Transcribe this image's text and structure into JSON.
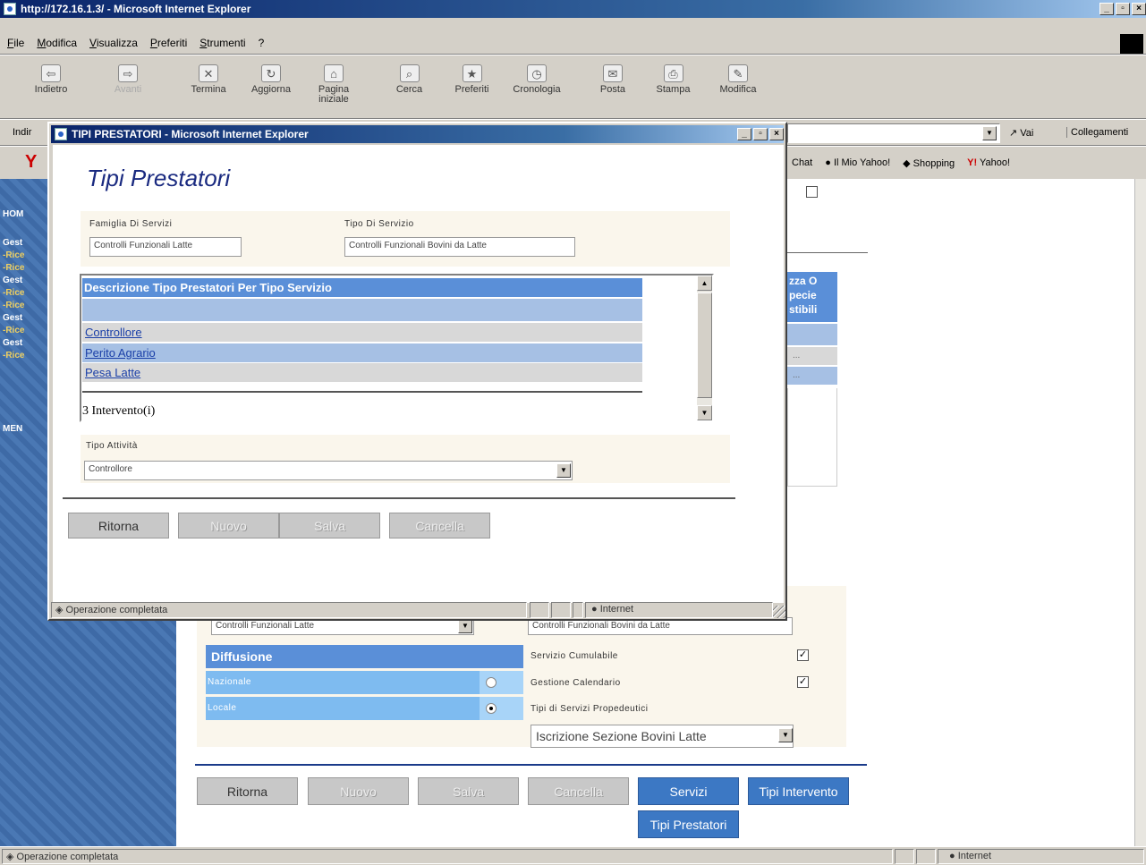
{
  "main_window": {
    "title": "http://172.16.1.3/ - Microsoft Internet Explorer",
    "menu": [
      "File",
      "Modifica",
      "Visualizza",
      "Preferiti",
      "Strumenti",
      "?"
    ],
    "toolbar": [
      "Indietro",
      "Avanti",
      "Termina",
      "Aggiorna",
      "Pagina iniziale",
      "Cerca",
      "Preferiti",
      "Cronologia",
      "Posta",
      "Stampa",
      "Modifica"
    ],
    "address_label": "Indir",
    "go_label": "Vai",
    "links_label": "Collegamenti",
    "yahoo_links": [
      "Chat",
      "Il Mio Yahoo!",
      "Shopping",
      "Yahoo!"
    ],
    "status": "Operazione completata",
    "zone": "Internet"
  },
  "left_nav": [
    "HOM",
    "Gest",
    "-Rice",
    "-Rice",
    "Gest",
    "-Rice",
    "-Rice",
    "Gest",
    "-Rice",
    "Gest",
    "-Rice",
    "MEN"
  ],
  "background_page": {
    "column_header_fragment": [
      "zza O",
      "pecie",
      "stibili"
    ],
    "row_fragments": [
      "...",
      "..."
    ],
    "famiglia_value": "Controlli Funzionali Latte",
    "tipo_value": "Controlli Funzionali Bovini da Latte",
    "diffusione_header": "Diffusione",
    "nazionale": "Nazionale",
    "locale": "Locale",
    "servizio_cumulabile": "Servizio Cumulabile",
    "gestione_calendario": "Gestione Calendario",
    "tipi_propedeutici": "Tipi di Servizi Propedeutici",
    "propedeutici_value": "Iscrizione Sezione Bovini Latte",
    "buttons": {
      "ritorna": "Ritorna",
      "nuovo": "Nuovo",
      "salva": "Salva",
      "cancella": "Cancella",
      "servizi": "Servizi",
      "tipi_intervento": "Tipi Intervento",
      "tipi_prestatori": "Tipi Prestatori"
    }
  },
  "popup": {
    "title": "TIPI PRESTATORI - Microsoft Internet Explorer",
    "heading": "Tipi Prestatori",
    "famiglia_label": "Famiglia Di Servizi",
    "famiglia_value": "Controlli Funzionali Latte",
    "tipo_label": "Tipo Di Servizio",
    "tipo_value": "Controlli Funzionali Bovini da Latte",
    "table_header": "Descrizione Tipo Prestatori Per Tipo Servizio",
    "rows": [
      "Controllore",
      "Perito Agrario",
      "Pesa Latte"
    ],
    "count": "3 Intervento(i)",
    "attivita_label": "Tipo Attività",
    "attivita_value": "Controllore",
    "buttons": {
      "ritorna": "Ritorna",
      "nuovo": "Nuovo",
      "salva": "Salva",
      "cancella": "Cancella"
    },
    "status": "Operazione completata",
    "zone": "Internet"
  },
  "colors": {
    "title_blue": "#0a246a",
    "header_blue": "#5a8fd8",
    "row_blue": "#a6c0e4",
    "row_gray": "#d8d8d8",
    "panel": "#faf6ec"
  }
}
